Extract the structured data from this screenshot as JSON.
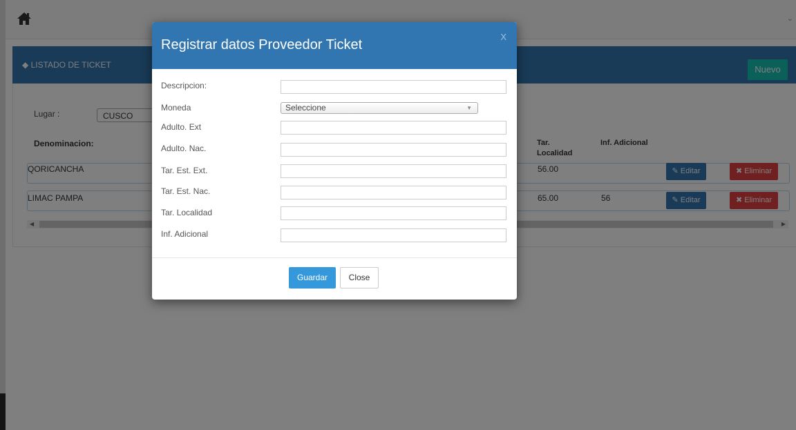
{
  "topbar": {
    "home_icon": "home-icon",
    "menu_caret_icon": "chevron-down-icon"
  },
  "panel": {
    "title": "◆ LISTADO DE TICKET",
    "new_button": "Nuevo"
  },
  "filter": {
    "lugar_label": "Lugar :",
    "lugar_value": "CUSCO"
  },
  "table": {
    "headers": {
      "denominacion": "Denominacion:",
      "tar_localidad_1": "Tar.",
      "tar_localidad_2": "Localidad",
      "inf_adicional": "Inf. Adicional"
    },
    "rows": [
      {
        "denominacion": "QORICANCHA",
        "tar_localidad": "56.00",
        "inf_adicional": "",
        "edit": "✎ Editar",
        "delete": "✖ Eliminar"
      },
      {
        "denominacion": "LIMAC PAMPA",
        "tar_localidad": "65.00",
        "inf_adicional": "56",
        "edit": "✎ Editar",
        "delete": "✖ Eliminar"
      }
    ]
  },
  "modal": {
    "title": "Registrar datos Proveedor Ticket",
    "close_x": "X",
    "fields": {
      "descripcion": "Descripcion:",
      "moneda": "Moneda",
      "moneda_value": "Seleccione",
      "adulto_ext": "Adulto. Ext",
      "adulto_nac": "Adulto. Nac.",
      "tar_est_ext": "Tar. Est. Ext.",
      "tar_est_nac": "Tar. Est. Nac.",
      "tar_localidad": "Tar. Localidad",
      "inf_adicional": "Inf. Adicional"
    },
    "save_button": "Guardar",
    "close_button": "Close"
  },
  "colors": {
    "primary": "#3276b1",
    "teal": "#16c1b2",
    "danger": "#e04141",
    "save": "#3498db"
  }
}
